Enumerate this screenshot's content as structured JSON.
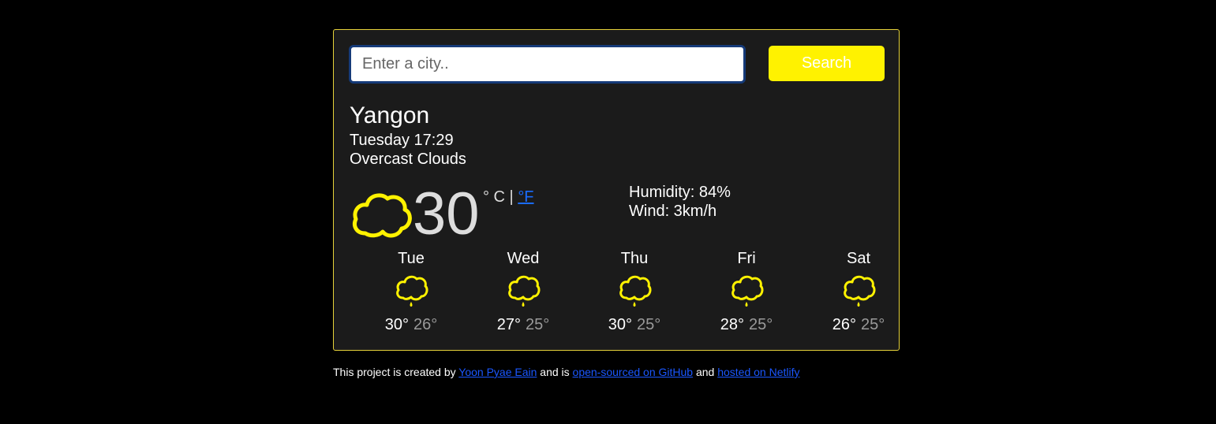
{
  "search": {
    "placeholder": "Enter a city..",
    "value": "",
    "button_label": "Search"
  },
  "current": {
    "city": "Yangon",
    "datetime": "Tuesday 17:29",
    "description": "Overcast Clouds",
    "temperature": "30",
    "unit_celsius": "° C |",
    "unit_fahrenheit": "°F",
    "humidity": "Humidity: 84%",
    "wind": "Wind: 3km/h",
    "icon": "cloud-icon"
  },
  "forecast": [
    {
      "day": "Tue",
      "max": "30°",
      "min": "26°",
      "icon": "rain-cloud-icon"
    },
    {
      "day": "Wed",
      "max": "27°",
      "min": "25°",
      "icon": "rain-cloud-icon"
    },
    {
      "day": "Thu",
      "max": "30°",
      "min": "25°",
      "icon": "rain-cloud-icon"
    },
    {
      "day": "Fri",
      "max": "28°",
      "min": "25°",
      "icon": "rain-cloud-icon"
    },
    {
      "day": "Sat",
      "max": "26°",
      "min": "25°",
      "icon": "rain-cloud-icon"
    }
  ],
  "footer": {
    "prefix": "This project is created by",
    "author_link": "Yoon Pyae Eain",
    "middle": "and is",
    "github_link": "open-sourced on GitHub",
    "and": "and",
    "netlify_link": "hosted on Netlify"
  },
  "colors": {
    "accent": "#fff200",
    "card_border": "#e6d23a",
    "card_bg": "#1b1b1b",
    "link": "#1a57ff"
  }
}
